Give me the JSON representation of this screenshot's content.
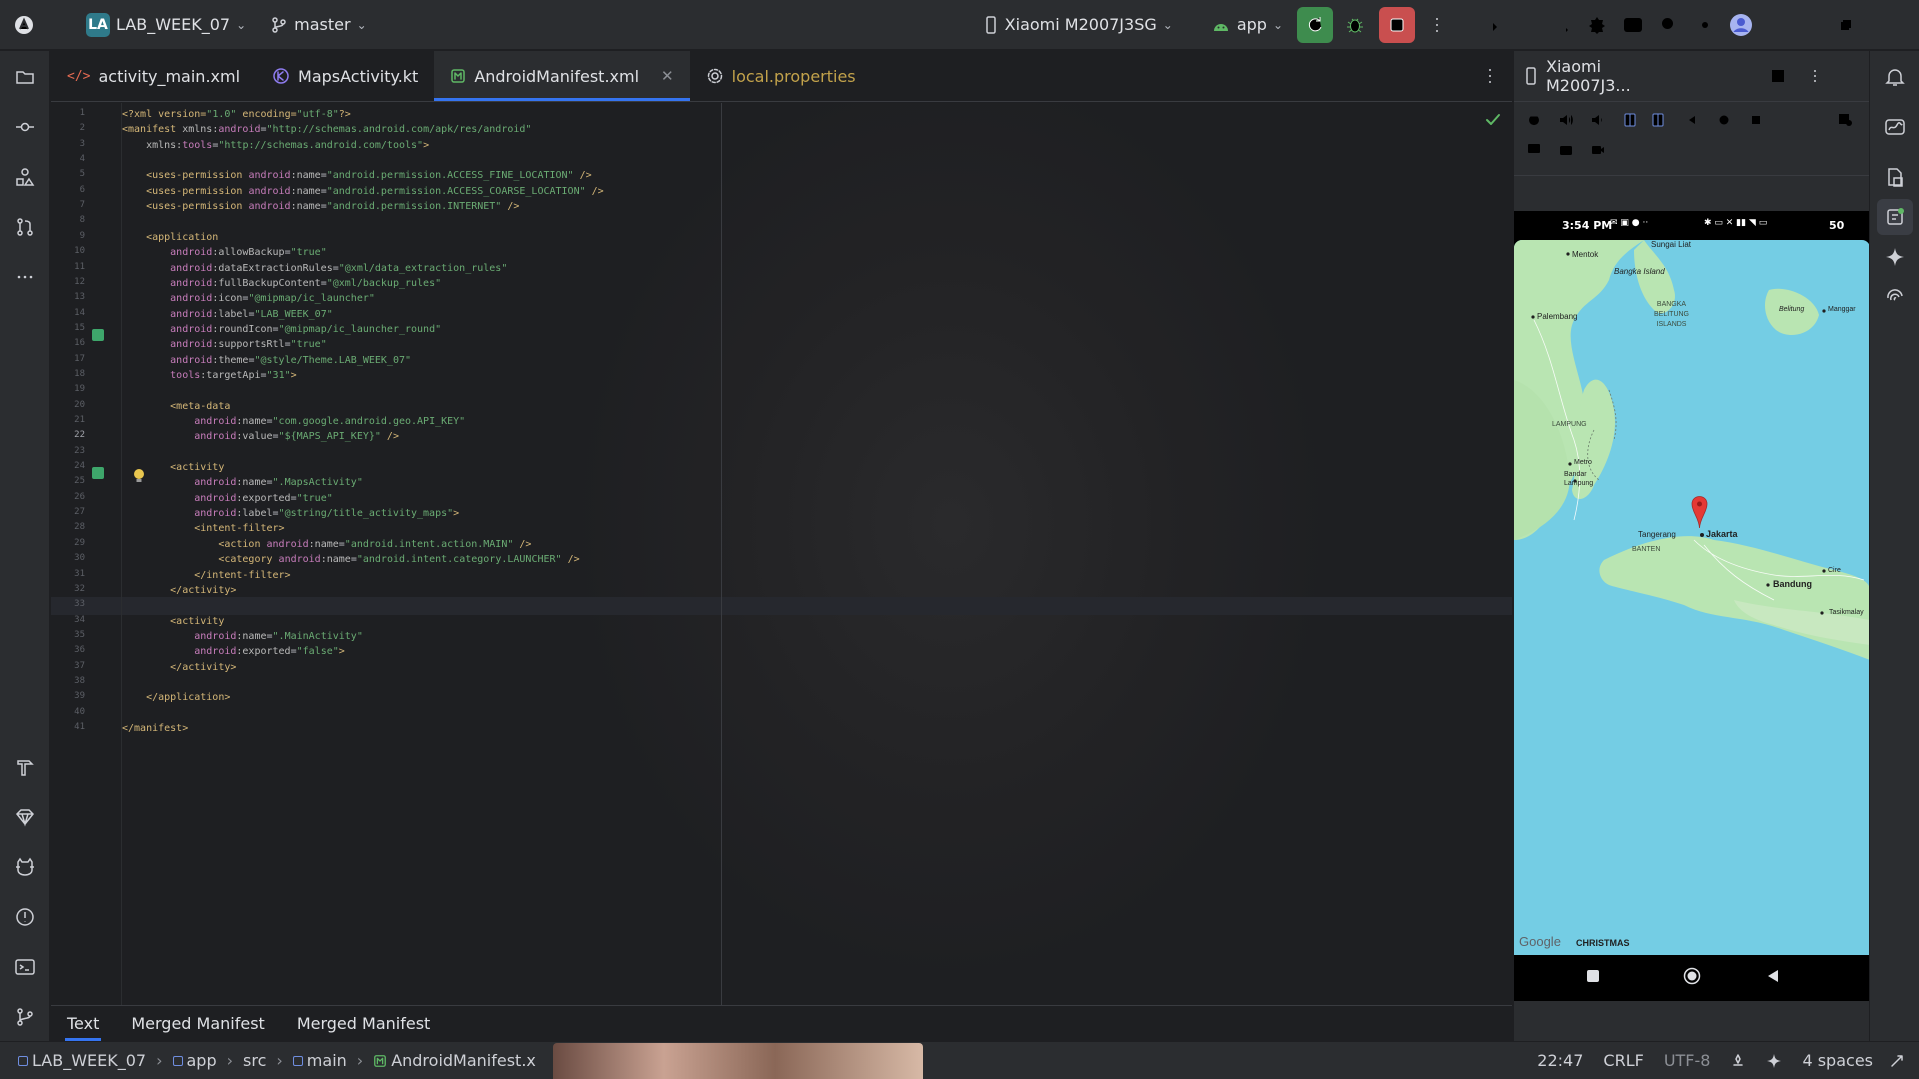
{
  "toolbar": {
    "project_badge": "LA",
    "project_name": "LAB_WEEK_07",
    "branch": "master",
    "device": "Xiaomi M2007J3SG",
    "run_config": "app"
  },
  "tabs": [
    {
      "label": "activity_main.xml",
      "icon": "xml-code-icon"
    },
    {
      "label": "MapsActivity.kt",
      "icon": "kotlin-file-icon"
    },
    {
      "label": "AndroidManifest.xml",
      "icon": "manifest-icon",
      "active": true
    },
    {
      "label": "local.properties",
      "icon": "settings-file-icon"
    }
  ],
  "code_lines": [
    [
      [
        "t-tag",
        "<?xml version="
      ],
      [
        "t-val",
        "\"1.0\""
      ],
      [
        "t-tag",
        " encoding="
      ],
      [
        "t-val",
        "\"utf-8\""
      ],
      [
        "t-tag",
        "?>"
      ]
    ],
    [
      [
        "t-tag",
        "<manifest "
      ],
      [
        "t-attr",
        "xmlns:"
      ],
      [
        "t-ns",
        "android"
      ],
      [
        "t-plain",
        "="
      ],
      [
        "t-val",
        "\"http://schemas.android.com/apk/res/android\""
      ]
    ],
    [
      [
        "t-attr",
        "    xmlns:"
      ],
      [
        "t-ns",
        "tools"
      ],
      [
        "t-plain",
        "="
      ],
      [
        "t-val",
        "\"http://schemas.android.com/tools\""
      ],
      [
        "t-tag",
        ">"
      ]
    ],
    [],
    [
      [
        "t-tag",
        "    <uses-permission "
      ],
      [
        "t-ns",
        "android"
      ],
      [
        "t-attr",
        ":name"
      ],
      [
        "t-plain",
        "="
      ],
      [
        "t-val",
        "\"android.permission.ACCESS_FINE_LOCATION\""
      ],
      [
        "t-tag",
        " />"
      ]
    ],
    [
      [
        "t-tag",
        "    <uses-permission "
      ],
      [
        "t-ns",
        "android"
      ],
      [
        "t-attr",
        ":name"
      ],
      [
        "t-plain",
        "="
      ],
      [
        "t-val",
        "\"android.permission.ACCESS_COARSE_LOCATION\""
      ],
      [
        "t-tag",
        " />"
      ]
    ],
    [
      [
        "t-tag",
        "    <uses-permission "
      ],
      [
        "t-ns",
        "android"
      ],
      [
        "t-attr",
        ":name"
      ],
      [
        "t-plain",
        "="
      ],
      [
        "t-val",
        "\"android.permission.INTERNET\""
      ],
      [
        "t-tag",
        " />"
      ]
    ],
    [],
    [
      [
        "t-tag",
        "    <application"
      ]
    ],
    [
      [
        "t-ns",
        "        android"
      ],
      [
        "t-attr",
        ":allowBackup"
      ],
      [
        "t-plain",
        "="
      ],
      [
        "t-val",
        "\"true\""
      ]
    ],
    [
      [
        "t-ns",
        "        android"
      ],
      [
        "t-attr",
        ":dataExtractionRules"
      ],
      [
        "t-plain",
        "="
      ],
      [
        "t-val",
        "\"@xml/data_extraction_rules\""
      ]
    ],
    [
      [
        "t-ns",
        "        android"
      ],
      [
        "t-attr",
        ":fullBackupContent"
      ],
      [
        "t-plain",
        "="
      ],
      [
        "t-val",
        "\"@xml/backup_rules\""
      ]
    ],
    [
      [
        "t-ns",
        "        android"
      ],
      [
        "t-attr",
        ":icon"
      ],
      [
        "t-plain",
        "="
      ],
      [
        "t-val",
        "\"@mipmap/ic_launcher\""
      ]
    ],
    [
      [
        "t-ns",
        "        android"
      ],
      [
        "t-attr",
        ":label"
      ],
      [
        "t-plain",
        "="
      ],
      [
        "t-val",
        "\"LAB_WEEK_07\""
      ]
    ],
    [
      [
        "t-ns",
        "        android"
      ],
      [
        "t-attr",
        ":roundIcon"
      ],
      [
        "t-plain",
        "="
      ],
      [
        "t-val",
        "\"@mipmap/ic_launcher_round\""
      ]
    ],
    [
      [
        "t-ns",
        "        android"
      ],
      [
        "t-attr",
        ":supportsRtl"
      ],
      [
        "t-plain",
        "="
      ],
      [
        "t-val",
        "\"true\""
      ]
    ],
    [
      [
        "t-ns",
        "        android"
      ],
      [
        "t-attr",
        ":theme"
      ],
      [
        "t-plain",
        "="
      ],
      [
        "t-val",
        "\"@style/Theme.LAB_WEEK_07\""
      ]
    ],
    [
      [
        "t-ns",
        "        tools"
      ],
      [
        "t-attr",
        ":targetApi"
      ],
      [
        "t-plain",
        "="
      ],
      [
        "t-val",
        "\"31\""
      ],
      [
        "t-tag",
        ">"
      ]
    ],
    [],
    [
      [
        "t-tag",
        "        <meta-data"
      ]
    ],
    [
      [
        "t-ns",
        "            android"
      ],
      [
        "t-attr",
        ":name"
      ],
      [
        "t-plain",
        "="
      ],
      [
        "t-val",
        "\"com.google.android.geo.API_KEY\""
      ]
    ],
    [
      [
        "t-ns",
        "            android"
      ],
      [
        "t-attr",
        ":value"
      ],
      [
        "t-plain",
        "="
      ],
      [
        "t-val",
        "\"${MAPS_API_KEY}\""
      ],
      [
        "t-tag",
        " />"
      ]
    ],
    [],
    [
      [
        "t-tag",
        "        <activity"
      ]
    ],
    [
      [
        "t-ns",
        "            android"
      ],
      [
        "t-attr",
        ":name"
      ],
      [
        "t-plain",
        "="
      ],
      [
        "t-val",
        "\".MapsActivity\""
      ]
    ],
    [
      [
        "t-ns",
        "            android"
      ],
      [
        "t-attr",
        ":exported"
      ],
      [
        "t-plain",
        "="
      ],
      [
        "t-val",
        "\"true\""
      ]
    ],
    [
      [
        "t-ns",
        "            android"
      ],
      [
        "t-attr",
        ":label"
      ],
      [
        "t-plain",
        "="
      ],
      [
        "t-val",
        "\"@string/title_activity_maps\""
      ],
      [
        "t-tag",
        ">"
      ]
    ],
    [
      [
        "t-tag",
        "            <intent-filter>"
      ]
    ],
    [
      [
        "t-tag",
        "                <action "
      ],
      [
        "t-ns",
        "android"
      ],
      [
        "t-attr",
        ":name"
      ],
      [
        "t-plain",
        "="
      ],
      [
        "t-val",
        "\"android.intent.action.MAIN\""
      ],
      [
        "t-tag",
        " />"
      ]
    ],
    [
      [
        "t-tag",
        "                <category "
      ],
      [
        "t-ns",
        "android"
      ],
      [
        "t-attr",
        ":name"
      ],
      [
        "t-plain",
        "="
      ],
      [
        "t-val",
        "\"android.intent.category.LAUNCHER\""
      ],
      [
        "t-tag",
        " />"
      ]
    ],
    [
      [
        "t-tag",
        "            </intent-filter>"
      ]
    ],
    [
      [
        "t-tag",
        "        </activity>"
      ]
    ],
    [],
    [
      [
        "t-tag",
        "        <activity"
      ]
    ],
    [
      [
        "t-ns",
        "            android"
      ],
      [
        "t-attr",
        ":name"
      ],
      [
        "t-plain",
        "="
      ],
      [
        "t-val",
        "\".MainActivity\""
      ]
    ],
    [
      [
        "t-ns",
        "            android"
      ],
      [
        "t-attr",
        ":exported"
      ],
      [
        "t-plain",
        "="
      ],
      [
        "t-val",
        "\"false\""
      ],
      [
        "t-tag",
        ">"
      ]
    ],
    [
      [
        "t-tag",
        "        </activity>"
      ]
    ],
    [],
    [
      [
        "t-tag",
        "    </application>"
      ]
    ],
    [],
    [
      [
        "t-tag",
        "</manifest>"
      ]
    ]
  ],
  "current_line": 22,
  "bottom_tabs": [
    "Text",
    "Merged Manifest",
    "Merged Manifest"
  ],
  "status": {
    "crumbs": [
      "LAB_WEEK_07",
      "app",
      "src",
      "main",
      "AndroidManifest.x"
    ],
    "position": "22:47",
    "line_sep": "CRLF",
    "encoding": "UTF-8",
    "indent": "4 spaces"
  },
  "device_panel": {
    "title": "Xiaomi M2007J3...",
    "phone_time": "3:54 PM",
    "battery": "50",
    "map_labels": {
      "sungai_liat": "Sungai Liat",
      "mentok": "Mentok",
      "bangka_island": "Bangka Island",
      "bangka_belitung": "BANGKA\nBELITUNG\nISLANDS",
      "palembang": "Palembang",
      "belitung": "Belitung",
      "manggar": "Manggar",
      "lampung": "LAMPUNG",
      "metro": "Metro",
      "bandar_lampung": "Bandar\nLampung",
      "tangerang": "Tangerang",
      "jakarta": "Jakarta",
      "banten": "BANTEN",
      "bandung": "Bandung",
      "tasikmalaya": "Tasikmalay",
      "cirebon": "Cire",
      "google": "Google",
      "christmas": "CHRISTMAS"
    }
  },
  "colors": {
    "accent": "#3574f0",
    "run_green": "#3e8c4e",
    "stop_red": "#c94f4f",
    "map_water": "#74cde4",
    "map_land": "#b9e5b2",
    "pin": "#e53935"
  }
}
